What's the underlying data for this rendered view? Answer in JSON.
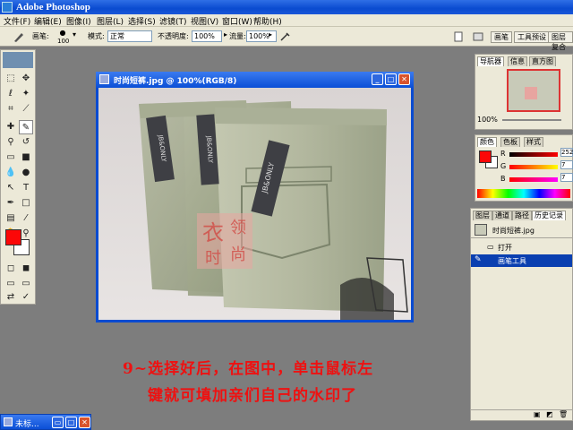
{
  "app": {
    "title": "Adobe Photoshop"
  },
  "menu": [
    "文件(F)",
    "编辑(E)",
    "图像(I)",
    "图层(L)",
    "选择(S)",
    "滤镜(T)",
    "视图(V)",
    "窗口(W)",
    "帮助(H)"
  ],
  "options": {
    "brush_label": "画笔:",
    "brush_size": "100",
    "mode_label": "模式:",
    "mode_value": "正常",
    "opacity_label": "不透明度:",
    "opacity_value": "100%",
    "flow_label": "流量:",
    "flow_value": "100%",
    "right_tabs": [
      "画笔",
      "工具预设",
      "图层复合"
    ]
  },
  "document": {
    "title": "时尚短裤.jpg @ 100%(RGB/8)",
    "tag_text": "JB&ONLY",
    "watermark_left": "衣",
    "watermark_right_top": "领",
    "watermark_left_bottom": "时",
    "watermark_right_bottom": "尚"
  },
  "navigator": {
    "tabs": [
      "导航器",
      "信息",
      "直方图"
    ],
    "zoom": "100%"
  },
  "color": {
    "tabs": [
      "颜色",
      "色板",
      "样式"
    ],
    "r_label": "R",
    "r_value": "252",
    "g_label": "G",
    "g_value": "7",
    "b_label": "B",
    "b_value": "7",
    "foreground": "#fc0707",
    "background": "#ffffff"
  },
  "history": {
    "tabs": [
      "图层",
      "通道",
      "路径",
      "历史记录"
    ],
    "snapshot": "时尚短裤.jpg",
    "items": [
      "打开",
      "画笔工具"
    ]
  },
  "caption": {
    "line1": "9~选择好后，在图中，单击鼠标左",
    "line2": "键就可填加亲们自己的水印了"
  },
  "minimized": {
    "label": "未标..."
  }
}
